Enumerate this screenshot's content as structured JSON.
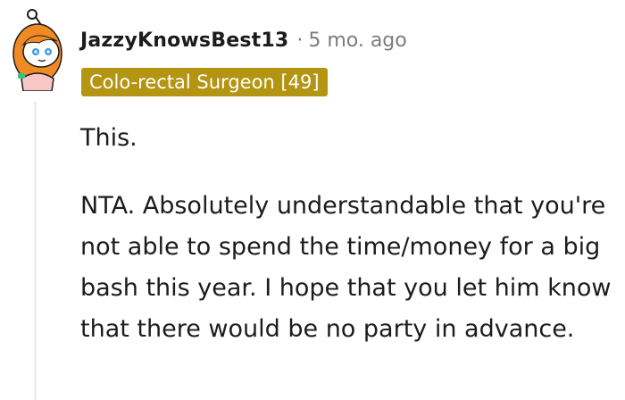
{
  "comment": {
    "author": "JazzyKnowsBest13",
    "separator": "·",
    "timestamp": "5 mo. ago",
    "flair": "Colo-rectal Surgeon [49]",
    "paragraphs": [
      "This.",
      "NTA. Absolutely understandable that you're not able to spend the time/money for a big bash this year. I hope that you let him know that there would be no party in advance."
    ]
  },
  "colors": {
    "flair_background": "#b39512",
    "text": "#1c1c1c",
    "meta": "#7c7c7c",
    "thread_line": "#eceef0"
  },
  "icons": {
    "avatar": "snoo-avatar-icon"
  }
}
